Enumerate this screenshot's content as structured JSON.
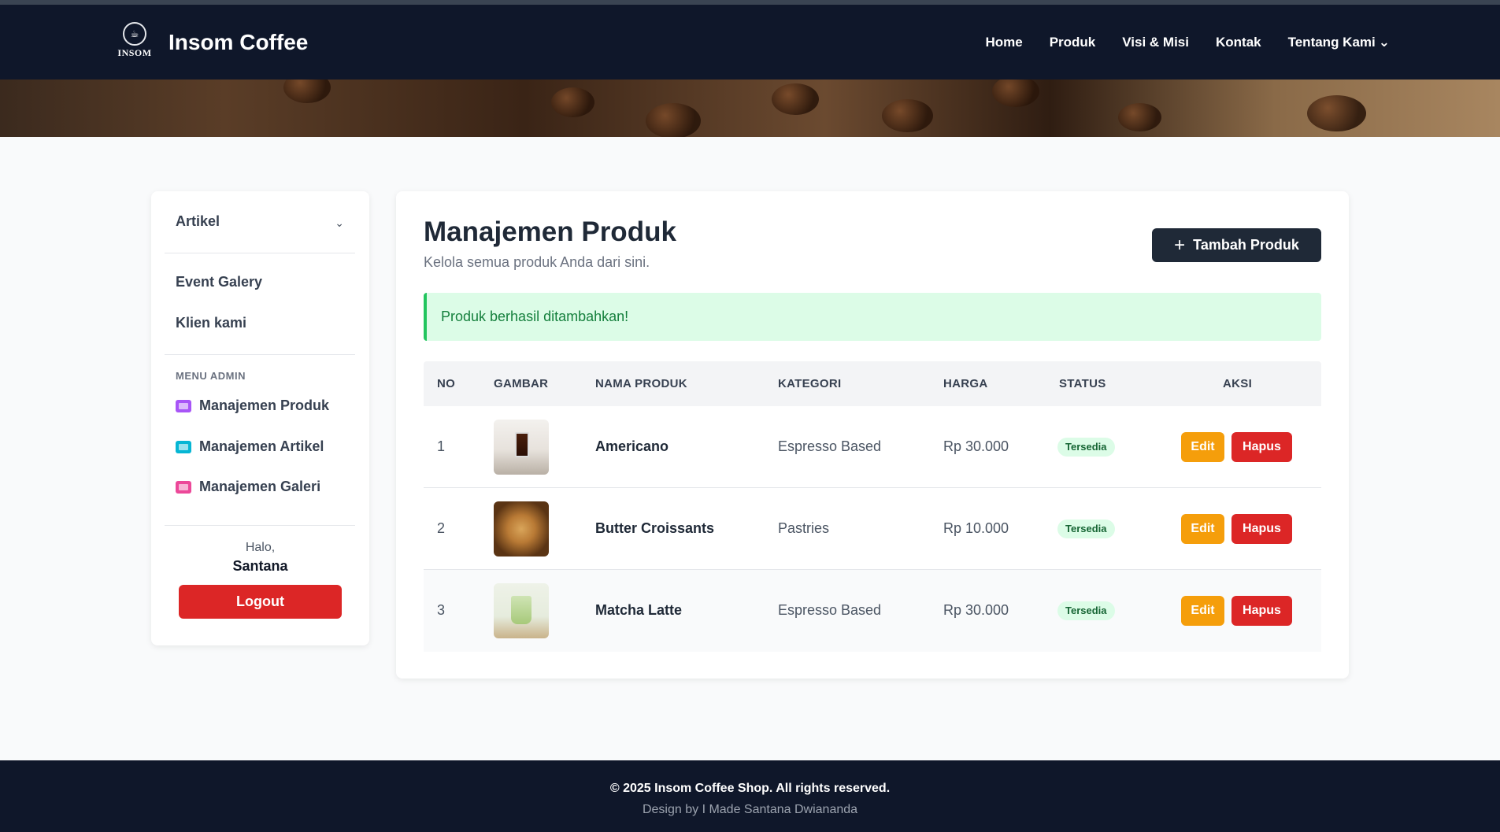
{
  "header": {
    "brand_name": "Insom Coffee",
    "logo_text": "INSOM",
    "nav": [
      "Home",
      "Produk",
      "Visi & Misi",
      "Kontak",
      "Tentang Kami"
    ]
  },
  "sidebar": {
    "items": [
      "Artikel",
      "Event Galery",
      "Klien kami"
    ],
    "admin_heading": "MENU ADMIN",
    "admin_items": [
      "Manajemen Produk",
      "Manajemen Artikel",
      "Manajemen Galeri"
    ],
    "greeting": "Halo,",
    "username": "Santana",
    "logout_label": "Logout"
  },
  "main": {
    "title": "Manajemen Produk",
    "subtitle": "Kelola semua produk Anda dari sini.",
    "add_button": "Tambah Produk",
    "alert": "Produk berhasil ditambahkan!",
    "columns": [
      "NO",
      "GAMBAR",
      "NAMA PRODUK",
      "KATEGORI",
      "HARGA",
      "STATUS",
      "AKSI"
    ],
    "rows": [
      {
        "no": "1",
        "name": "Americano",
        "category": "Espresso Based",
        "price": "Rp 30.000",
        "status": "Tersedia",
        "edit": "Edit",
        "delete": "Hapus"
      },
      {
        "no": "2",
        "name": "Butter Croissants",
        "category": "Pastries",
        "price": "Rp 10.000",
        "status": "Tersedia",
        "edit": "Edit",
        "delete": "Hapus"
      },
      {
        "no": "3",
        "name": "Matcha Latte",
        "category": "Espresso Based",
        "price": "Rp 30.000",
        "status": "Tersedia",
        "edit": "Edit",
        "delete": "Hapus"
      }
    ]
  },
  "footer": {
    "copyright": "© 2025 Insom Coffee Shop. All rights reserved.",
    "design": "Design by I Made Santana Dwiananda"
  },
  "colors": {
    "navbar": "#0f172a",
    "accent_dark": "#1f2937",
    "danger": "#dc2626",
    "warning": "#f59e0b",
    "success_bg": "#dcfce7"
  }
}
